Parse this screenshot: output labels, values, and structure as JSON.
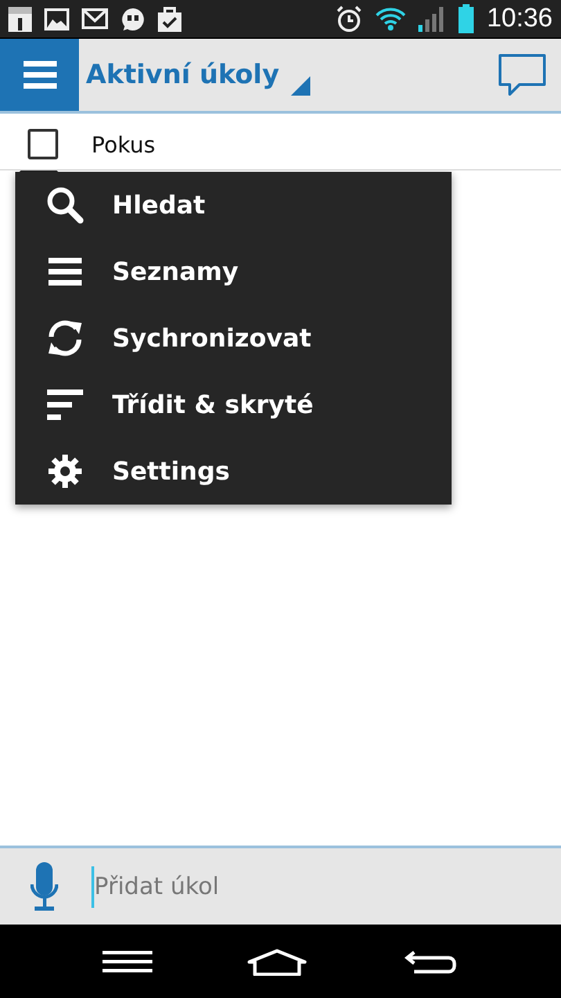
{
  "status_bar": {
    "time": "10:36"
  },
  "app_bar": {
    "title": "Aktivní úkoly"
  },
  "tasks": [
    {
      "title": "Pokus",
      "checked": false
    }
  ],
  "menu": {
    "items": [
      {
        "label": "Hledat",
        "kind": "search"
      },
      {
        "label": "Seznamy",
        "kind": "list"
      },
      {
        "label": "Sychronizovat",
        "kind": "sync"
      },
      {
        "label": "Třídit & skryté",
        "kind": "sort"
      },
      {
        "label": "Settings",
        "kind": "settings"
      }
    ]
  },
  "add_bar": {
    "placeholder": "Přidat úkol"
  }
}
